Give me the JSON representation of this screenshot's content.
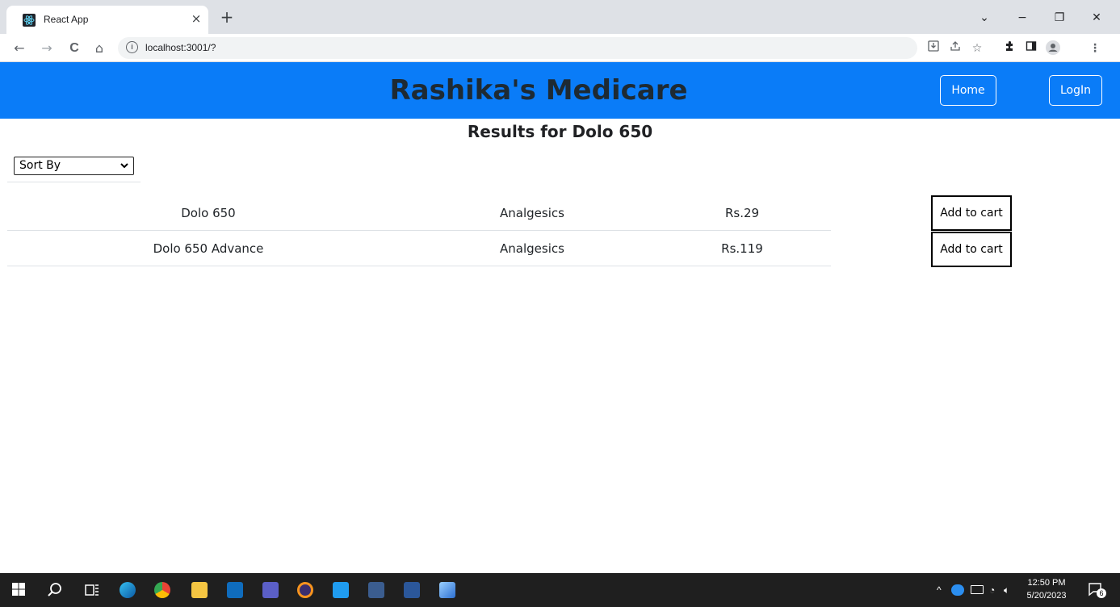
{
  "browser": {
    "tab_title": "React App",
    "tab_close": "×",
    "new_tab": "+",
    "url": "localhost:3001/?",
    "info": "i",
    "nav": {
      "back": "←",
      "forward": "→",
      "reload": "C",
      "home": "⌂"
    },
    "window": {
      "dropdown": "⌄",
      "minimize": "−",
      "restore": "❐",
      "close": "✕"
    }
  },
  "header": {
    "brand": "Rashika's Medicare",
    "home_label": "Home",
    "login_label": "LogIn"
  },
  "results": {
    "title": "Results for Dolo 650",
    "sort_label": "Sort By",
    "items": [
      {
        "name": "Dolo 650",
        "category": "Analgesics",
        "price": "Rs.29",
        "cart_label": "Add to cart"
      },
      {
        "name": "Dolo 650 Advance",
        "category": "Analgesics",
        "price": "Rs.119",
        "cart_label": "Add to cart"
      }
    ]
  },
  "taskbar": {
    "time": "12:50 PM",
    "date": "5/20/2023",
    "notification_count": "6"
  },
  "colors": {
    "header_bg": "#0a7cf8",
    "brand_text": "#1e2a33",
    "taskbar_bg": "#1f1f1f"
  }
}
